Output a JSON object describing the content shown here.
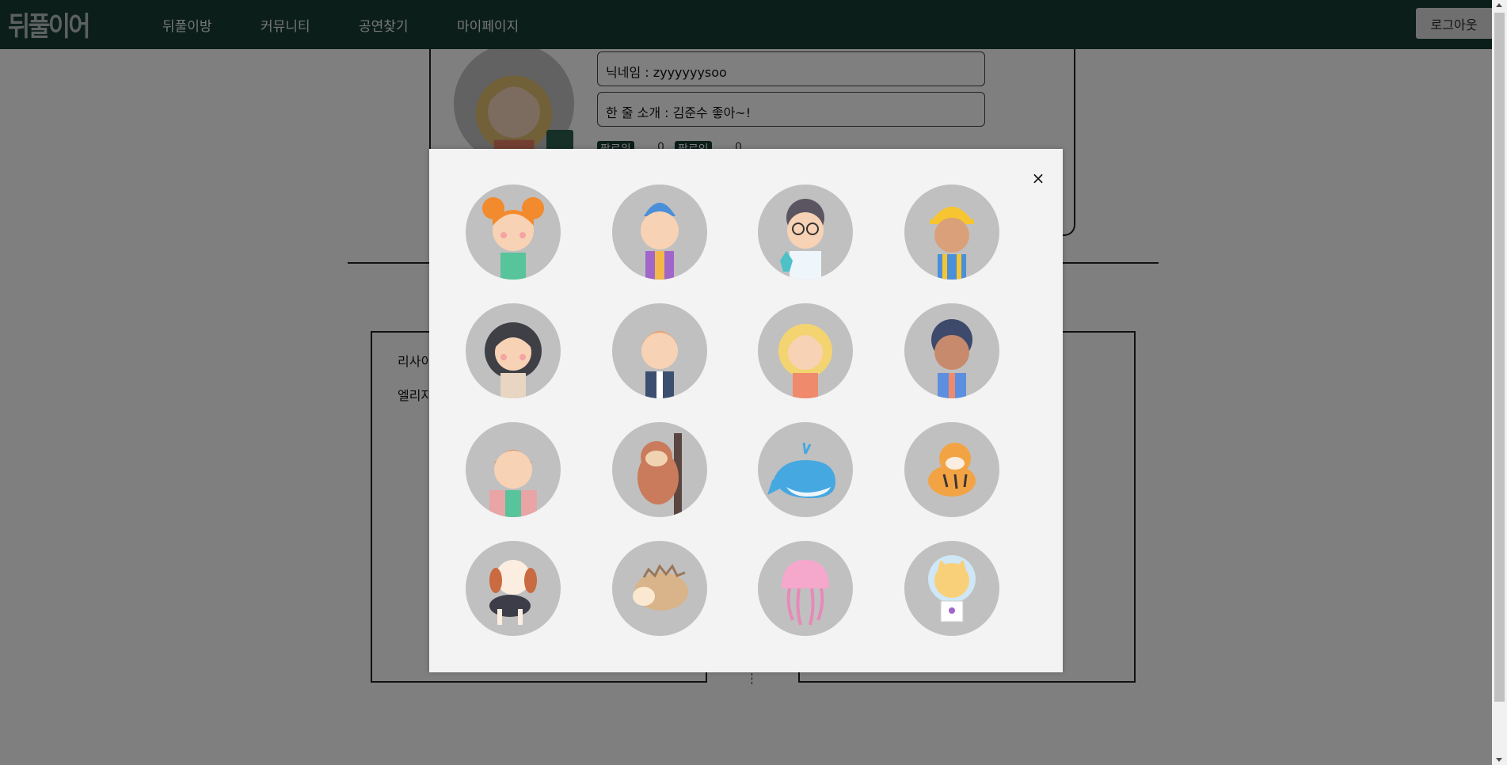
{
  "nav": {
    "logo": "뒤풀이어",
    "items": [
      "뒤풀이방",
      "커뮤니티",
      "공연찾기",
      "마이페이지"
    ],
    "logout": "로그아웃"
  },
  "profile": {
    "nickname": "닉네임 : zyyyyyysoo",
    "intro": "한 줄 소개 : 김준수 좋아~!",
    "follow_tags": [
      "팔로워",
      "팔로잉"
    ],
    "follow_counts": [
      "0",
      "0"
    ]
  },
  "boxes": {
    "left_line1": "리사이",
    "left_line2": "엘리자"
  },
  "modal": {
    "close": "×",
    "avatars": [
      "girl-pigtails-avatar",
      "boy-blue-hair-avatar",
      "scientist-glasses-avatar",
      "construction-worker-avatar",
      "woman-dark-hair-avatar",
      "boy-ginger-hair-avatar",
      "woman-blonde-avatar",
      "man-curly-hair-avatar",
      "boy-backpack-avatar",
      "sloth-avatar",
      "whale-avatar",
      "tiger-avatar",
      "beagle-dog-avatar",
      "hedgehog-avatar",
      "jellyfish-avatar",
      "astronaut-cat-avatar"
    ]
  },
  "colors": {
    "navbar": "#163c34",
    "avatar_bg": "#c0c0c0",
    "modal_bg": "#f3f3f3"
  }
}
